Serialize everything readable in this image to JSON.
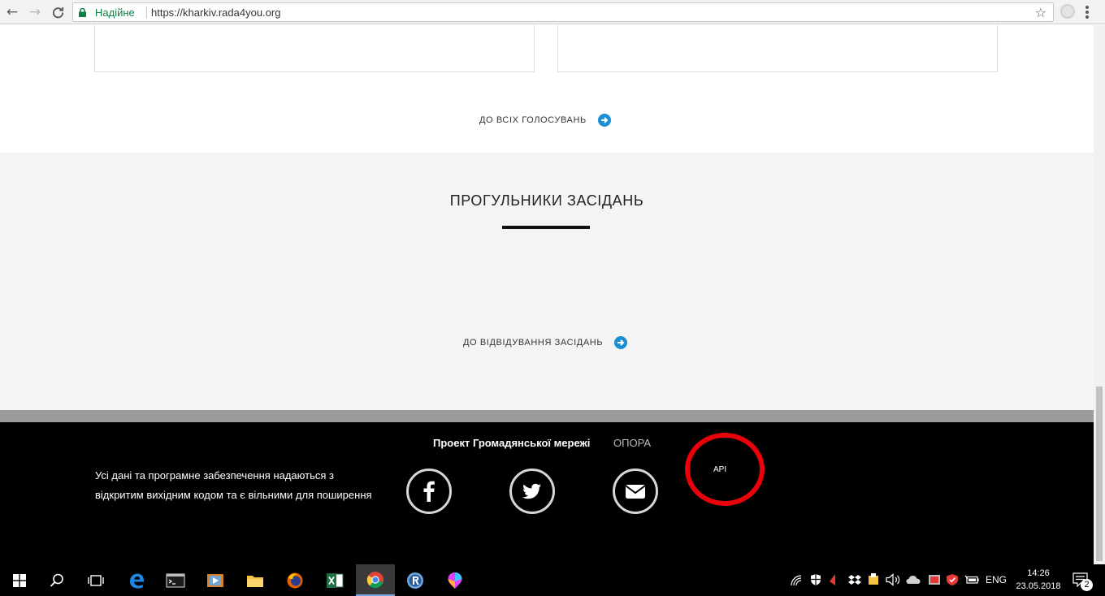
{
  "browser": {
    "secure_label": "Надійне",
    "url": "https://kharkiv.rada4you.org"
  },
  "page": {
    "votes_link": "ДО ВСІХ ГОЛОСУВАНЬ",
    "truants_title": "ПРОГУЛЬНИКИ ЗАСІДАНЬ",
    "attendance_link": "ДО ВІДВІДУВАННЯ ЗАСІДАНЬ"
  },
  "footer": {
    "project_text": "Проект Громадянської мережі",
    "opora_link": "ОПОРА",
    "desc_line1": "Усі дані та програмне забезпечення надаються з",
    "desc_line2": "відкритим вихідним кодом та є вільними для поширення",
    "api_link": "API"
  },
  "taskbar": {
    "language": "ENG",
    "time": "14:26",
    "date": "23.05.2018",
    "notifications": "2"
  },
  "colors": {
    "accent": "#1a8fd5",
    "highlight": "#e8000b"
  }
}
